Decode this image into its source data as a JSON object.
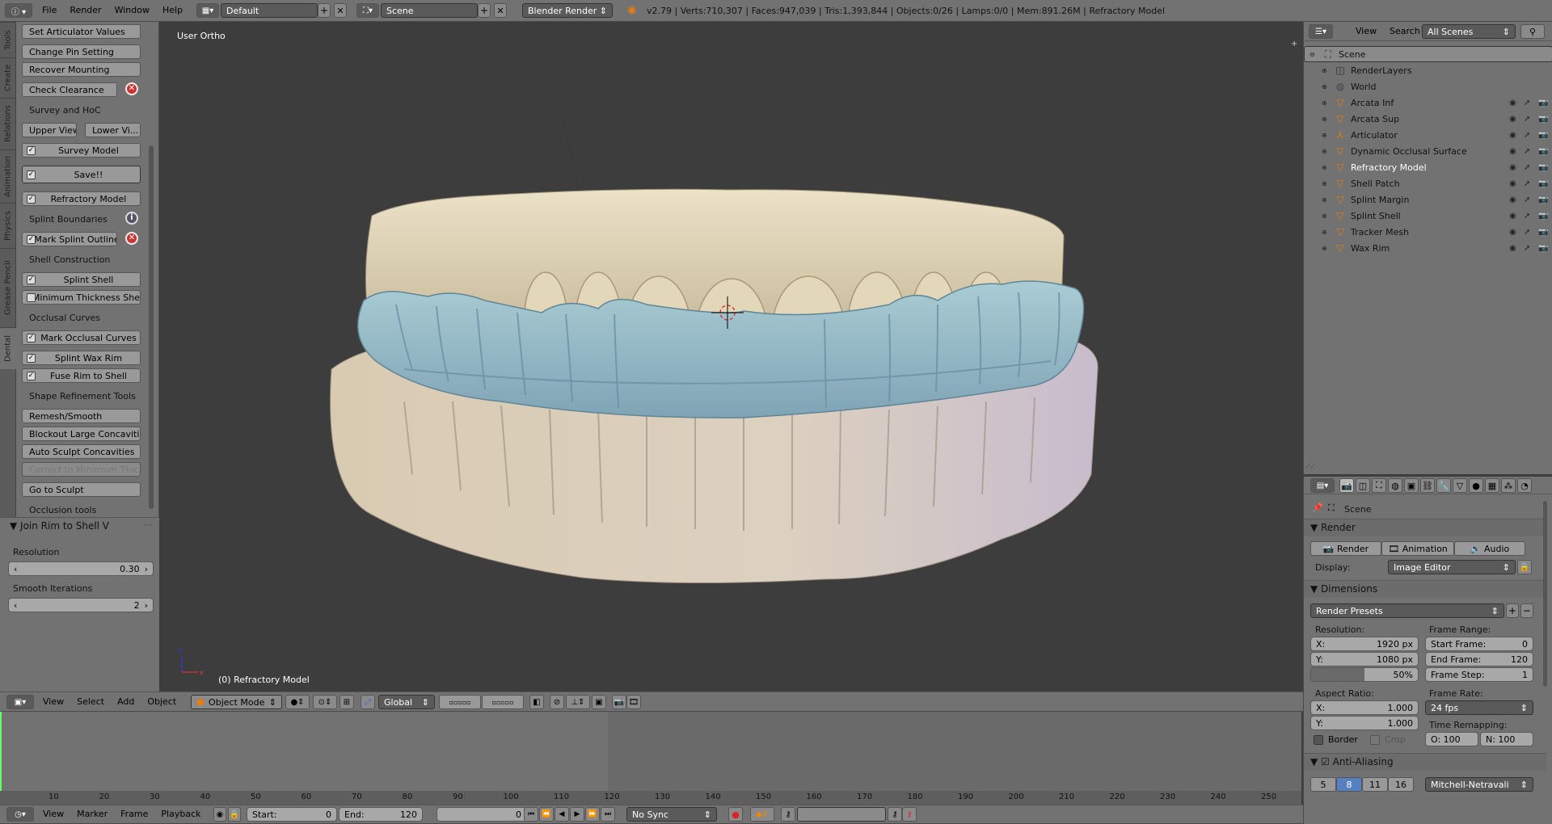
{
  "info_bar": {
    "menus": [
      "File",
      "Render",
      "Window",
      "Help"
    ],
    "layout": "Default",
    "scene": "Scene",
    "engine": "Blender Render",
    "stats": "v2.79 | Verts:710,307 | Faces:947,039 | Tris:1,393,844 | Objects:0/26 | Lamps:0/0 | Mem:891.26M | Refractory Model"
  },
  "toolshelf": {
    "tabs": [
      "Tools",
      "Create",
      "Relations",
      "Animation",
      "Physics",
      "Grease Pencil",
      "Dental"
    ],
    "active_tab": "Dental",
    "items": {
      "set_articulator": "Set Articulator Values",
      "change_pin": "Change Pin Setting",
      "recover_mounting": "Recover Mounting",
      "check_clearance": "Check Clearance",
      "survey_label": "Survey and HoC",
      "upper_view": "Upper View",
      "lower_view": "Lower Vi...",
      "survey_model": "Survey Model",
      "save": "Save!!",
      "refractory_model": "Refractory Model",
      "splint_boundaries": "Splint Boundaries",
      "mark_splint_outline": "Mark Splint Outline",
      "shell_construction": "Shell Construction",
      "splint_shell": "Splint Shell",
      "min_thickness": "Minimum Thickness Shell",
      "occlusal_curves": "Occlusal Curves",
      "mark_occlusal": "Mark Occlusal Curves",
      "splint_wax_rim": "Splint Wax Rim",
      "fuse_rim": "Fuse Rim to Shell",
      "shape_refinement": "Shape Refinement Tools",
      "remesh": "Remesh/Smooth",
      "blockout": "Blockout Large Concaviti...",
      "auto_sculpt": "Auto Sculpt Concavities",
      "correct_min": "Correct to Minimum Thic...",
      "go_to_sculpt": "Go to Sculpt",
      "occlusion_tools": "Occlusion tools"
    },
    "operator": {
      "title": "Join Rim to Shell V",
      "resolution_label": "Resolution",
      "resolution_value": "0.30",
      "smooth_label": "Smooth Iterations",
      "smooth_value": "2"
    }
  },
  "viewport": {
    "view_name": "User Ortho",
    "object_label": "(0) Refractory Model",
    "header": {
      "menus": [
        "View",
        "Select",
        "Add",
        "Object"
      ],
      "mode": "Object Mode",
      "orientation": "Global"
    }
  },
  "outliner": {
    "menus": [
      "View",
      "Search"
    ],
    "filter": "All Scenes",
    "rows": [
      {
        "name": "Scene",
        "indent": 0,
        "icon": "scene"
      },
      {
        "name": "RenderLayers",
        "indent": 1,
        "icon": "renderlayer"
      },
      {
        "name": "World",
        "indent": 1,
        "icon": "world"
      },
      {
        "name": "Arcata Inf",
        "indent": 1,
        "icon": "mesh"
      },
      {
        "name": "Arcata Sup",
        "indent": 1,
        "icon": "mesh"
      },
      {
        "name": "Articulator",
        "indent": 1,
        "icon": "armature"
      },
      {
        "name": "Dynamic Occlusal Surface",
        "indent": 1,
        "icon": "mesh"
      },
      {
        "name": "Refractory Model",
        "indent": 1,
        "icon": "mesh"
      },
      {
        "name": "Shell Patch",
        "indent": 1,
        "icon": "mesh"
      },
      {
        "name": "Splint Margin",
        "indent": 1,
        "icon": "mesh"
      },
      {
        "name": "Splint Shell",
        "indent": 1,
        "icon": "mesh"
      },
      {
        "name": "Tracker Mesh",
        "indent": 1,
        "icon": "mesh"
      },
      {
        "name": "Wax Rim",
        "indent": 1,
        "icon": "mesh"
      }
    ]
  },
  "properties": {
    "context": "Scene",
    "render_panel": "Render",
    "render_btn": "Render",
    "animation_btn": "Animation",
    "audio_btn": "Audio",
    "display_label": "Display:",
    "display_value": "Image Editor",
    "dimensions_panel": "Dimensions",
    "presets": "Render Presets",
    "resolution_label": "Resolution:",
    "res_x": "1920 px",
    "res_y": "1080 px",
    "res_pct": "50%",
    "frame_range_label": "Frame Range:",
    "start_frame": "0",
    "end_frame": "120",
    "frame_step": "1",
    "aspect_label": "Aspect Ratio:",
    "aspect_x": "1.000",
    "aspect_y": "1.000",
    "frame_rate_label": "Frame Rate:",
    "fps": "24 fps",
    "time_remap": "Time Remapping:",
    "remap_old": "O: 100",
    "remap_new": "N: 100",
    "border": "Border",
    "crop": "Crop",
    "aa_panel": "Anti-Aliasing",
    "aa_samples": [
      "5",
      "8",
      "11",
      "16"
    ],
    "aa_active": "8",
    "aa_filter": "Mitchell-Netravali",
    "x_label": "X:",
    "y_label": "Y:",
    "start_frame_label": "Start Frame:",
    "end_frame_label": "End Frame:",
    "frame_step_label": "Frame Step:"
  },
  "timeline": {
    "ticks": [
      "10",
      "20",
      "30",
      "40",
      "50",
      "60",
      "70",
      "80",
      "90",
      "100",
      "110",
      "120",
      "130",
      "140",
      "150",
      "160",
      "170",
      "180",
      "190",
      "200",
      "210",
      "220",
      "230",
      "240",
      "250"
    ],
    "menus": [
      "View",
      "Marker",
      "Frame",
      "Playback"
    ],
    "start_label": "Start:",
    "start": "0",
    "end_label": "End:",
    "end": "120",
    "current": "0",
    "sync": "No Sync"
  }
}
